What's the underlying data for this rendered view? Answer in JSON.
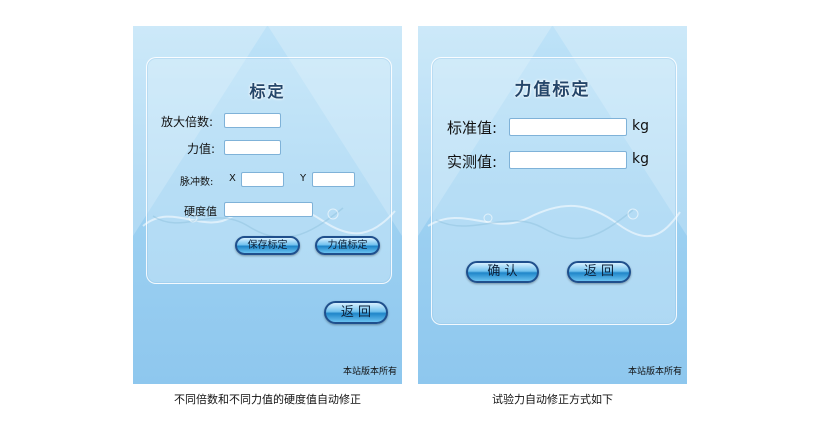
{
  "left_screen": {
    "title": "标定",
    "magnification_label": "放大倍数:",
    "force_label": "力值:",
    "pulse_label": "脉冲数:",
    "pulse_x_label": "X",
    "pulse_y_label": "Y",
    "hardness_label": "硬度值",
    "save_calibration_label": "保存标定",
    "force_calibration_label": "力值标定",
    "back_label": "返 回",
    "copyright": "本站版本所有"
  },
  "right_screen": {
    "title": "力值标定",
    "standard_value_label": "标准值:",
    "standard_unit": "kg",
    "measured_value_label": "实测值:",
    "measured_unit": "kg",
    "confirm_label": "确 认",
    "back_label": "返 回",
    "copyright": "本站版本所有"
  },
  "captions": {
    "left": "不同倍数和不同力值的硬度值自动修正",
    "right": "试验力自动修正方式如下"
  },
  "colors": {
    "screen_background": "#9fd2f2",
    "button_border": "#1f4f8c",
    "title_text": "#25466a"
  }
}
